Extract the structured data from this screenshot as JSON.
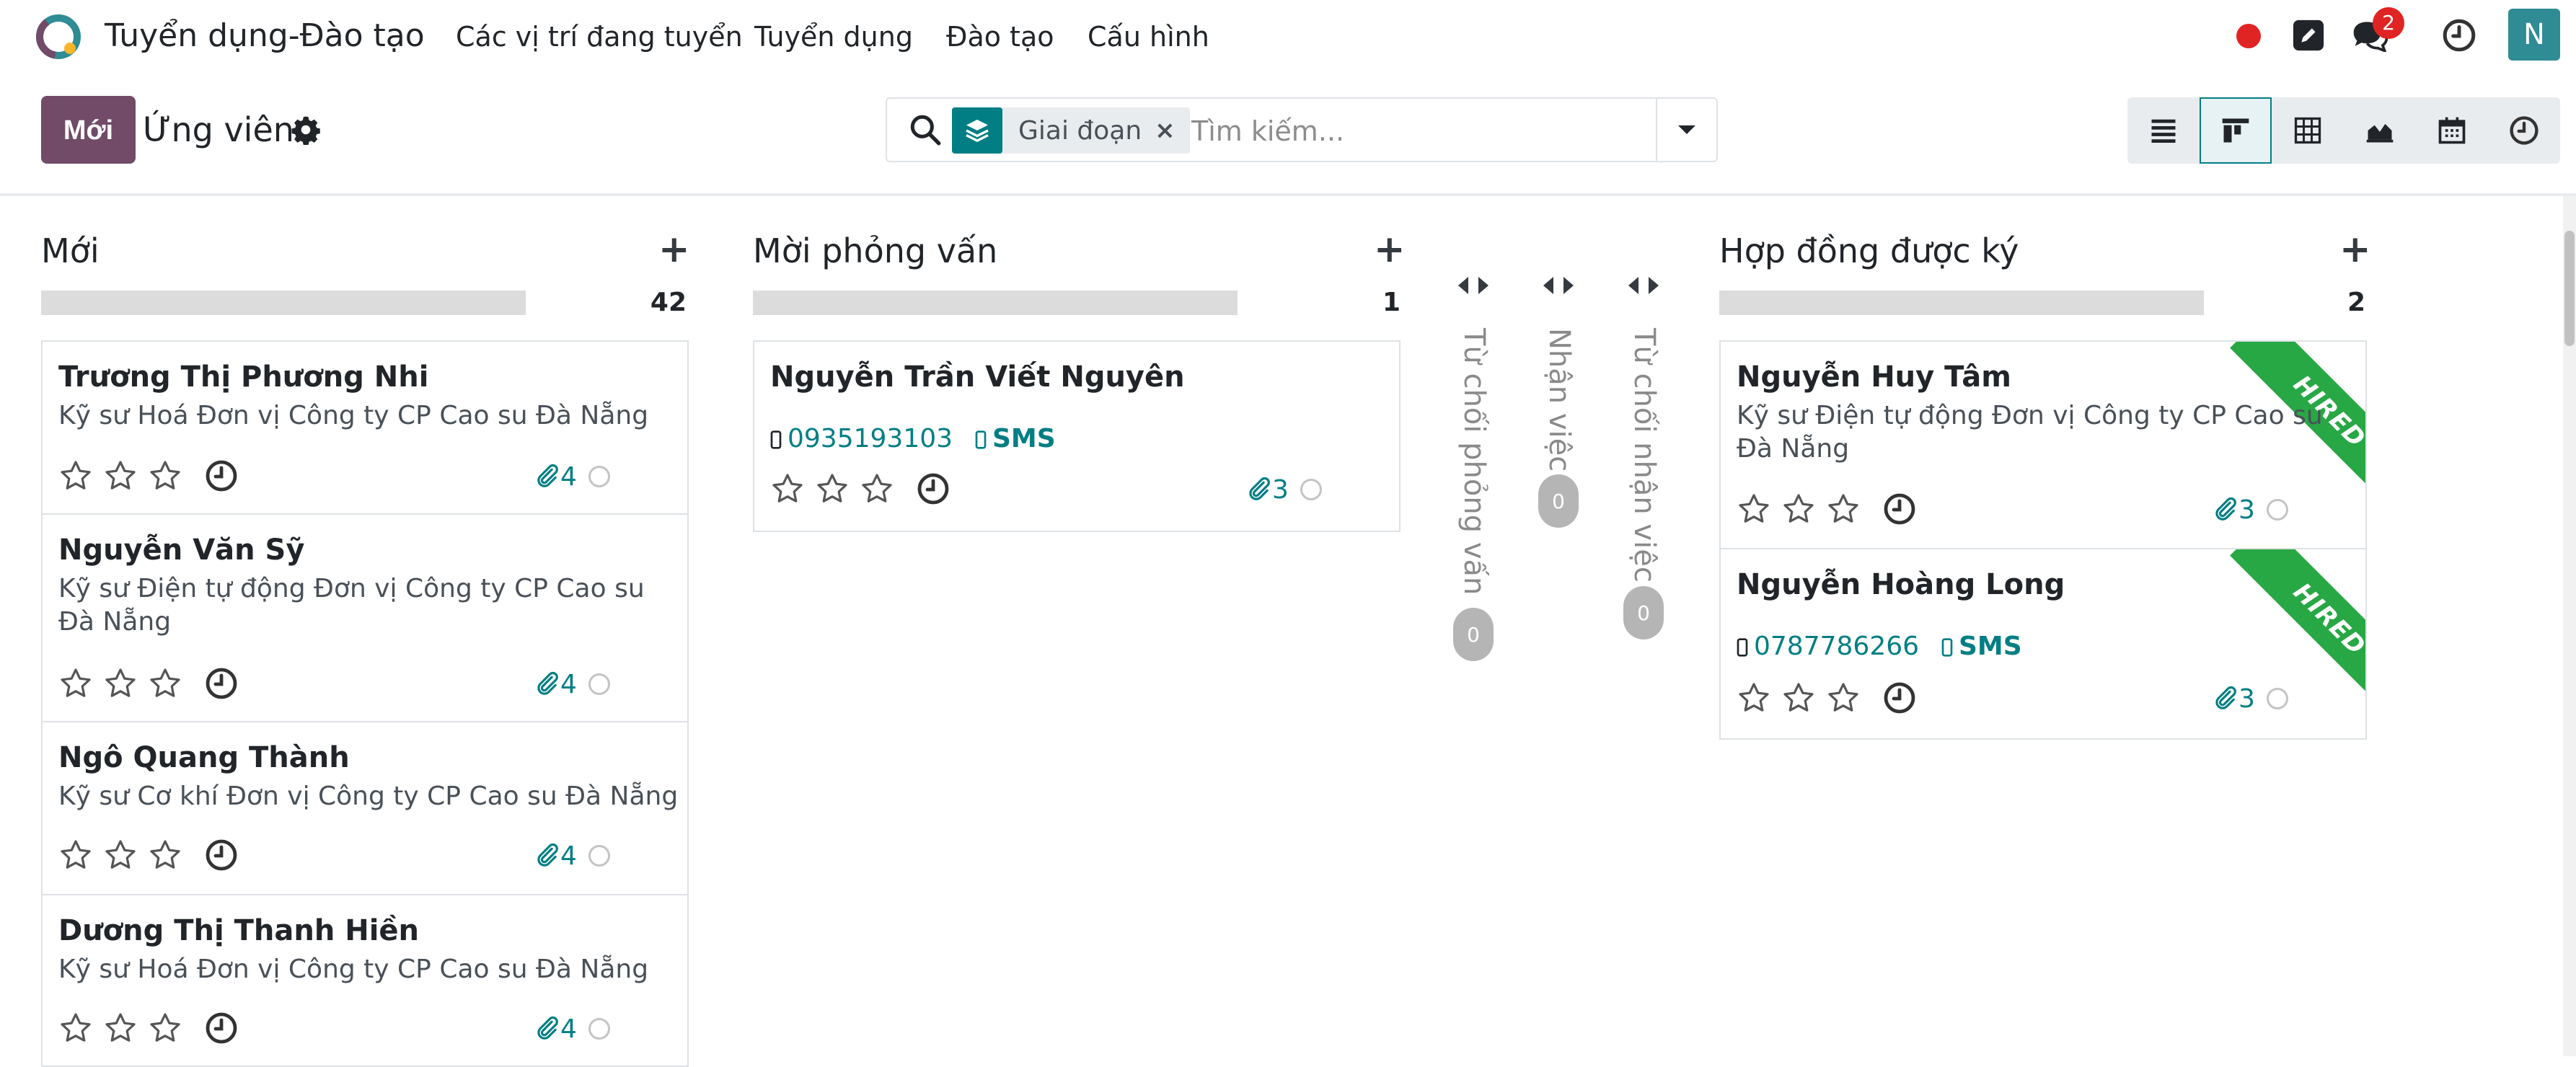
{
  "app": {
    "title": "Tuyển dụng-Đào tạo",
    "logo_icon": "odoo-logo-icon"
  },
  "nav": {
    "menu": [
      "Các vị trí đang tuyển",
      "Tuyển dụng",
      "Đào tạo",
      "Cấu hình"
    ],
    "chat_badge": "2",
    "avatar_letter": "N"
  },
  "control": {
    "new_button": "Mới",
    "breadcrumb": "Ứng viên",
    "search": {
      "facet": "Giai đoạn",
      "placeholder": "Tìm kiếm..."
    },
    "views": [
      "list-view-icon",
      "kanban-view-icon",
      "pivot-view-icon",
      "graph-view-icon",
      "calendar-view-icon",
      "activity-view-icon"
    ],
    "active_view": "kanban-view-icon"
  },
  "colors": {
    "primary": "#714b67",
    "teal": "#017e84",
    "hired": "#28a745",
    "badge": "#e02424"
  },
  "columns": [
    {
      "title": "Mới",
      "count": "42",
      "cards": [
        {
          "name": "Trương Thị Phương Nhi",
          "job": "Kỹ sư Hoá Đơn vị Công ty CP Cao su Đà Nẵng",
          "attachments": "4"
        },
        {
          "name": "Nguyễn Văn Sỹ",
          "job": "Kỹ sư Điện tự động Đơn vị Công ty CP Cao su Đà Nẵng",
          "attachments": "4"
        },
        {
          "name": "Ngô Quang Thành",
          "job": "Kỹ sư Cơ khí Đơn vị Công ty CP Cao su Đà Nẵng",
          "attachments": "4"
        },
        {
          "name": "Dương Thị Thanh Hiền",
          "job": "Kỹ sư Hoá Đơn vị Công ty CP Cao su Đà Nẵng",
          "attachments": "4"
        }
      ]
    },
    {
      "title": "Mời phỏng vấn",
      "count": "1",
      "cards": [
        {
          "name": "Nguyễn Trần Viết Nguyên",
          "phone": "0935193103",
          "sms": "SMS",
          "attachments": "3"
        }
      ]
    },
    {
      "title": "Hợp đồng được ký",
      "count": "2",
      "cards": [
        {
          "name": "Nguyễn Huy Tâm",
          "job": "Kỹ sư Điện tự động Đơn vị Công ty CP Cao su Đà Nẵng",
          "attachments": "3",
          "ribbon": "HIRED"
        },
        {
          "name": "Nguyễn Hoàng Long",
          "phone": "0787786266",
          "sms": "SMS",
          "attachments": "3",
          "ribbon": "HIRED"
        }
      ]
    }
  ],
  "folded": [
    {
      "label": "Từ chối phỏng vấn",
      "count": "0"
    },
    {
      "label": "Nhận việc",
      "count": "0"
    },
    {
      "label": "Từ chối nhận việc",
      "count": "0"
    }
  ]
}
